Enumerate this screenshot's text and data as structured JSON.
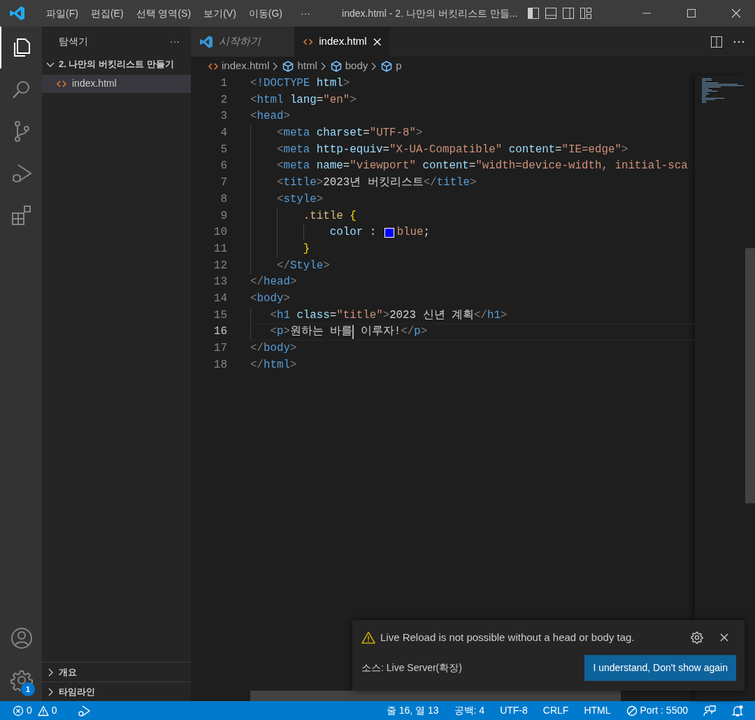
{
  "title_bar": {
    "menus": [
      "파일(F)",
      "편집(E)",
      "선택 영역(S)",
      "보기(V)",
      "이동(G)"
    ],
    "more": "···",
    "title": "index.html - 2. 나만의 버킷리스트 만들..."
  },
  "activity_bar": {
    "items": [
      {
        "kind": "explorer",
        "selected": true
      },
      {
        "kind": "search",
        "selected": false
      },
      {
        "kind": "source-control",
        "selected": false
      },
      {
        "kind": "run-debug",
        "selected": false
      },
      {
        "kind": "extensions",
        "selected": false
      }
    ],
    "bottom": [
      {
        "kind": "accounts"
      },
      {
        "kind": "manage",
        "badge": "1"
      }
    ]
  },
  "sidebar": {
    "title": "탐색기",
    "more": "···",
    "folder": {
      "label": "2. 나만의 버킷리스트 만들기",
      "expanded": true,
      "children": [
        {
          "label": "index.html",
          "selected": true
        }
      ]
    },
    "sections": [
      {
        "label": "개요",
        "expanded": false
      },
      {
        "label": "타임라인",
        "expanded": false
      }
    ]
  },
  "tabs": [
    {
      "label": "시작하기",
      "kind": "welcome",
      "preview": true,
      "selected": false
    },
    {
      "label": "index.html",
      "kind": "html",
      "preview": false,
      "selected": true
    }
  ],
  "breadcrumbs": [
    {
      "label": "index.html",
      "kind": "file"
    },
    {
      "label": "html",
      "kind": "element"
    },
    {
      "label": "body",
      "kind": "element"
    },
    {
      "label": "p",
      "kind": "element"
    }
  ],
  "editor": {
    "lines": [
      {
        "number": "1",
        "current": false,
        "tokens": [
          {
            "kind": "punct",
            "text": "<"
          },
          {
            "kind": "tag",
            "text": "!DOCTYPE"
          },
          {
            "kind": "attr",
            "text": " html"
          },
          {
            "kind": "punct",
            "text": ">"
          }
        ]
      },
      {
        "number": "2",
        "current": false,
        "tokens": [
          {
            "kind": "punct",
            "text": "<"
          },
          {
            "kind": "tag",
            "text": "html"
          },
          {
            "kind": "attr",
            "text": " lang"
          },
          {
            "kind": "plain",
            "text": "="
          },
          {
            "kind": "string",
            "text": "\"en\""
          },
          {
            "kind": "punct",
            "text": ">"
          }
        ]
      },
      {
        "number": "3",
        "current": false,
        "tokens": [
          {
            "kind": "punct",
            "text": "<"
          },
          {
            "kind": "tag",
            "text": "head"
          },
          {
            "kind": "punct",
            "text": ">"
          }
        ]
      },
      {
        "number": "4",
        "current": false,
        "tokens": [
          {
            "kind": "punct",
            "text": "    <"
          },
          {
            "kind": "tag",
            "text": "meta"
          },
          {
            "kind": "attr",
            "text": " charset"
          },
          {
            "kind": "plain",
            "text": "="
          },
          {
            "kind": "string",
            "text": "\"UTF-8\""
          },
          {
            "kind": "punct",
            "text": ">"
          }
        ]
      },
      {
        "number": "5",
        "current": false,
        "tokens": [
          {
            "kind": "punct",
            "text": "    <"
          },
          {
            "kind": "tag",
            "text": "meta"
          },
          {
            "kind": "attr",
            "text": " http-equiv"
          },
          {
            "kind": "plain",
            "text": "="
          },
          {
            "kind": "string",
            "text": "\"X-UA-Compatible\""
          },
          {
            "kind": "attr",
            "text": " content"
          },
          {
            "kind": "plain",
            "text": "="
          },
          {
            "kind": "string",
            "text": "\"IE=edge\""
          },
          {
            "kind": "punct",
            "text": ">"
          }
        ]
      },
      {
        "number": "6",
        "current": false,
        "tokens": [
          {
            "kind": "punct",
            "text": "    <"
          },
          {
            "kind": "tag",
            "text": "meta"
          },
          {
            "kind": "attr",
            "text": " name"
          },
          {
            "kind": "plain",
            "text": "="
          },
          {
            "kind": "string",
            "text": "\"viewport\""
          },
          {
            "kind": "attr",
            "text": " content"
          },
          {
            "kind": "plain",
            "text": "="
          },
          {
            "kind": "string",
            "text": "\"width=device-width, initial-sca"
          }
        ]
      },
      {
        "number": "7",
        "current": false,
        "tokens": [
          {
            "kind": "punct",
            "text": "    <"
          },
          {
            "kind": "tag",
            "text": "title"
          },
          {
            "kind": "punct",
            "text": ">"
          },
          {
            "kind": "plain",
            "text": "2023년 버킷리스트"
          },
          {
            "kind": "punct",
            "text": "</"
          },
          {
            "kind": "tag",
            "text": "title"
          },
          {
            "kind": "punct",
            "text": ">"
          }
        ]
      },
      {
        "number": "8",
        "current": false,
        "tokens": [
          {
            "kind": "punct",
            "text": "    <"
          },
          {
            "kind": "tag",
            "text": "style"
          },
          {
            "kind": "punct",
            "text": ">"
          }
        ]
      },
      {
        "number": "9",
        "current": false,
        "tokens": [
          {
            "kind": "selector",
            "text": "        .title"
          },
          {
            "kind": "brace",
            "text": " {"
          }
        ]
      },
      {
        "number": "10",
        "current": false,
        "tokens": [
          {
            "kind": "property",
            "text": "            color"
          },
          {
            "kind": "plain",
            "text": " : "
          },
          {
            "kind": "swatch",
            "color": "#0000ff"
          },
          {
            "kind": "string",
            "text": "blue"
          },
          {
            "kind": "plain",
            "text": ";"
          }
        ]
      },
      {
        "number": "11",
        "current": false,
        "tokens": [
          {
            "kind": "brace",
            "text": "        }"
          }
        ]
      },
      {
        "number": "12",
        "current": false,
        "tokens": [
          {
            "kind": "punct",
            "text": "    </"
          },
          {
            "kind": "tag",
            "text": "Style"
          },
          {
            "kind": "punct",
            "text": ">"
          }
        ]
      },
      {
        "number": "13",
        "current": false,
        "tokens": [
          {
            "kind": "punct",
            "text": "</"
          },
          {
            "kind": "tag",
            "text": "head"
          },
          {
            "kind": "punct",
            "text": ">"
          }
        ]
      },
      {
        "number": "14",
        "current": false,
        "tokens": [
          {
            "kind": "punct",
            "text": "<"
          },
          {
            "kind": "tag",
            "text": "body"
          },
          {
            "kind": "punct",
            "text": ">"
          }
        ]
      },
      {
        "number": "15",
        "current": false,
        "tokens": [
          {
            "kind": "punct",
            "text": "   <"
          },
          {
            "kind": "tag",
            "text": "h1"
          },
          {
            "kind": "attr",
            "text": " class"
          },
          {
            "kind": "plain",
            "text": "="
          },
          {
            "kind": "string",
            "text": "\"title\""
          },
          {
            "kind": "punct",
            "text": ">"
          },
          {
            "kind": "plain",
            "text": "2023 신년 계획"
          },
          {
            "kind": "punct",
            "text": "</"
          },
          {
            "kind": "tag",
            "text": "h1"
          },
          {
            "kind": "punct",
            "text": ">"
          }
        ]
      },
      {
        "number": "16",
        "current": true,
        "tokens": [
          {
            "kind": "punct",
            "text": "   <"
          },
          {
            "kind": "tag",
            "text": "p"
          },
          {
            "kind": "punct",
            "text": ">"
          },
          {
            "kind": "plain",
            "text": "원하는 바를"
          },
          {
            "kind": "caret"
          },
          {
            "kind": "plain",
            "text": " 이루자!"
          },
          {
            "kind": "punct",
            "text": "</"
          },
          {
            "kind": "tag",
            "text": "p"
          },
          {
            "kind": "punct",
            "text": ">"
          }
        ]
      },
      {
        "number": "17",
        "current": false,
        "tokens": [
          {
            "kind": "punct",
            "text": "</"
          },
          {
            "kind": "tag",
            "text": "body"
          },
          {
            "kind": "punct",
            "text": ">"
          }
        ]
      },
      {
        "number": "18",
        "current": false,
        "tokens": [
          {
            "kind": "punct",
            "text": "</"
          },
          {
            "kind": "tag",
            "text": "html"
          },
          {
            "kind": "punct",
            "text": ">"
          }
        ]
      }
    ]
  },
  "notification": {
    "message": "Live Reload is not possible without a head or body tag.",
    "source": "소스: Live Server(확장)",
    "button": "I understand, Don't show again"
  },
  "status_bar": {
    "left": [
      {
        "kind": "errors",
        "text": "0"
      },
      {
        "kind": "warnings",
        "text": "0"
      },
      {
        "kind": "debug"
      }
    ],
    "right": [
      {
        "kind": "text",
        "text": "줄 16, 열 13"
      },
      {
        "kind": "text",
        "text": "공백: 4"
      },
      {
        "kind": "text",
        "text": "UTF-8"
      },
      {
        "kind": "text",
        "text": "CRLF"
      },
      {
        "kind": "text",
        "text": "HTML"
      },
      {
        "kind": "port",
        "text": "Port : 5500"
      },
      {
        "kind": "feedback"
      },
      {
        "kind": "bell"
      }
    ]
  }
}
